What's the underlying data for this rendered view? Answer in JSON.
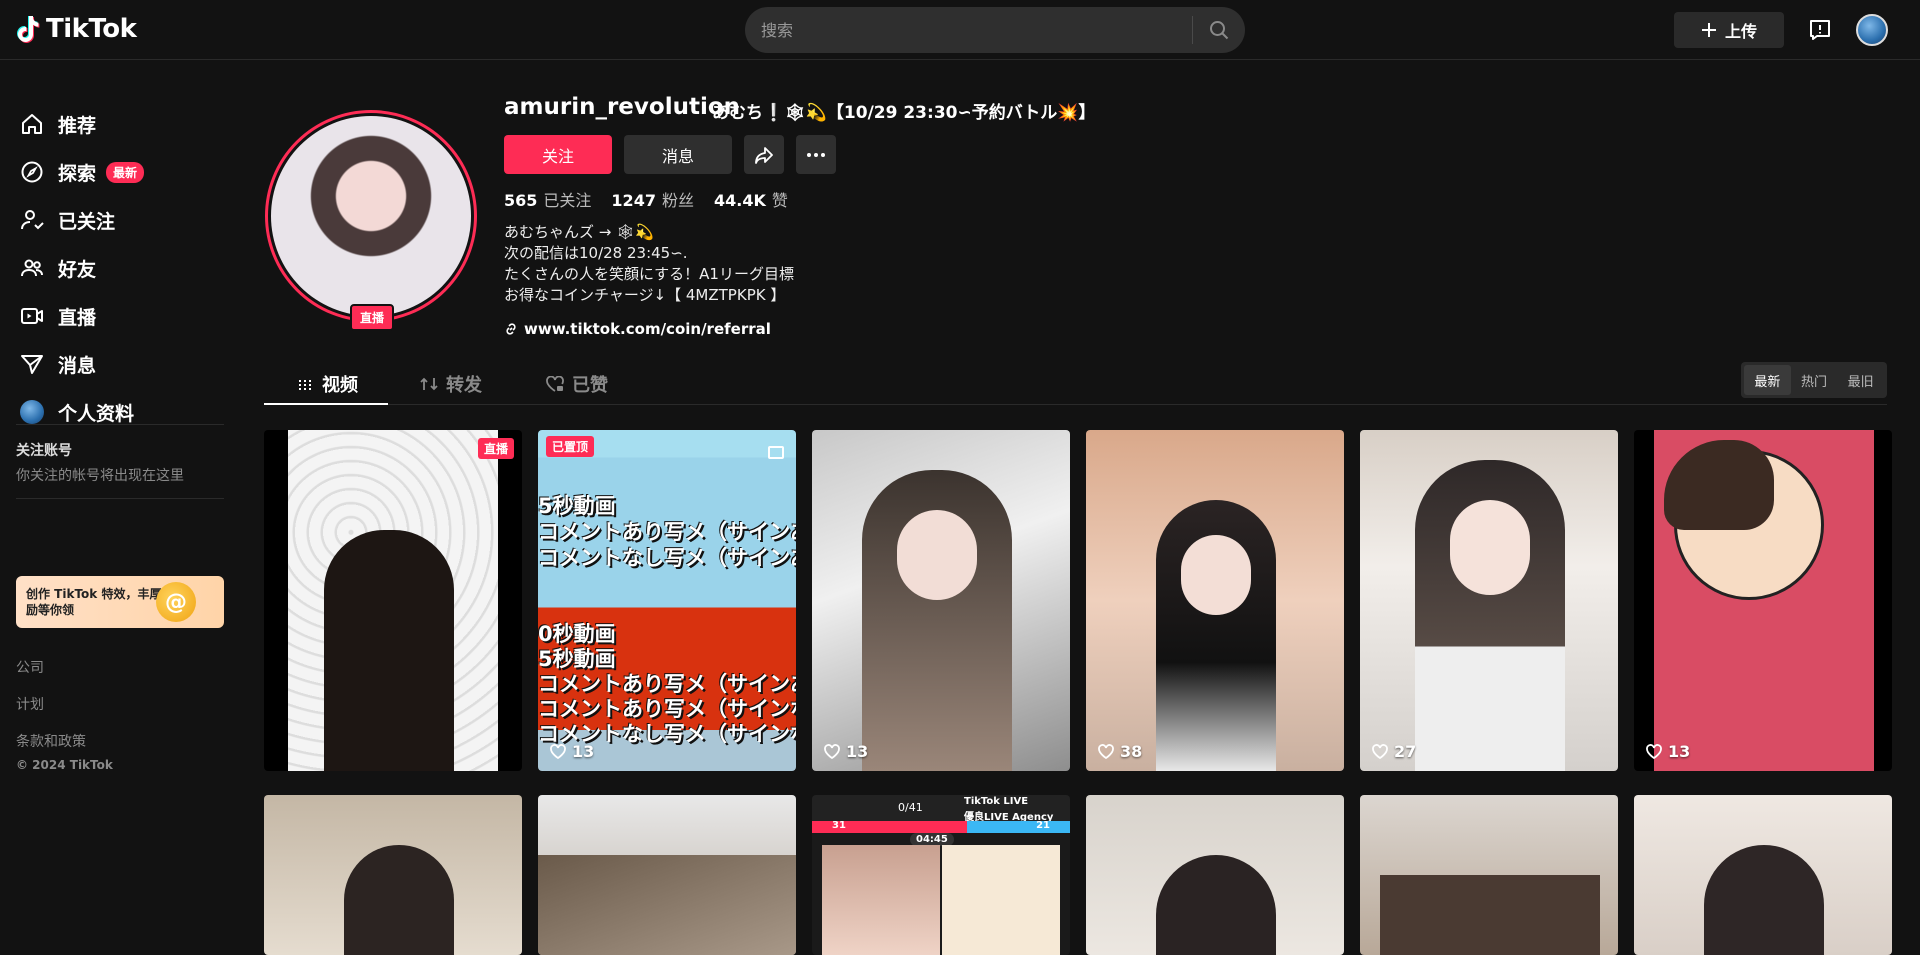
{
  "app": {
    "logo": "TikTok"
  },
  "header": {
    "search_placeholder": "搜索",
    "upload_label": "上传"
  },
  "sidebar": {
    "items": [
      {
        "label": "推荐"
      },
      {
        "label": "探索",
        "badge": "最新"
      },
      {
        "label": "已关注"
      },
      {
        "label": "好友"
      },
      {
        "label": "直播"
      },
      {
        "label": "消息"
      },
      {
        "label": "个人资料"
      }
    ],
    "following_title": "关注账号",
    "following_sub": "你关注的帐号将出现在这里",
    "promo_text": "创作 TikTok 特效，丰厚奖励等你领",
    "footer_links": [
      "公司",
      "计划",
      "条款和政策"
    ],
    "copyright": "© 2024 TikTok"
  },
  "profile": {
    "live_tag": "直播",
    "username": "amurin_revolution",
    "nickname": "あむち❕🕸💫【10/29 23:30∽予約バトル💥】",
    "follow_label": "关注",
    "message_label": "消息",
    "stats": {
      "following_count": "565",
      "following_label": "已关注",
      "followers_count": "1247",
      "followers_label": "粉丝",
      "likes_count": "44.4K",
      "likes_label": "赞"
    },
    "bio": [
      "あむちゃんズ → 🕸💫",
      "次の配信は10/28 23:45∽.",
      "たくさんの人を笑顔にする！A1リーグ目標",
      "お得なコインチャージ↓【 4MZTPKPK 】"
    ],
    "link": "www.tiktok.com/coin/referral"
  },
  "tabs": [
    {
      "label": "视频"
    },
    {
      "label": "转发"
    },
    {
      "label": "已赞"
    }
  ],
  "sort": [
    "最新",
    "热门",
    "最旧"
  ],
  "videos_row1": [
    {
      "tag": "直播",
      "likes": ""
    },
    {
      "tag": "已置顶",
      "likes": "13",
      "lines": [
        "5秒動画",
        "コメントあり写メ（サインあ",
        "コメントなし写メ（サインあ",
        "0秒動画",
        "5秒動画",
        "コメントあり写メ（サインあ",
        "コメントあり写メ（サインな",
        "コメントなし写メ（サインな"
      ]
    },
    {
      "likes": "13"
    },
    {
      "likes": "38"
    },
    {
      "likes": "27"
    },
    {
      "likes": "13"
    }
  ],
  "video_row2_overlay": {
    "counter": "0/41",
    "brand": "TikTok LIVE",
    "agency": "優良LIVE Agency",
    "left_score": "31",
    "right_score": "21",
    "timer": "04:45"
  },
  "colors": {
    "accent": "#fe2c55",
    "background": "#121212"
  }
}
